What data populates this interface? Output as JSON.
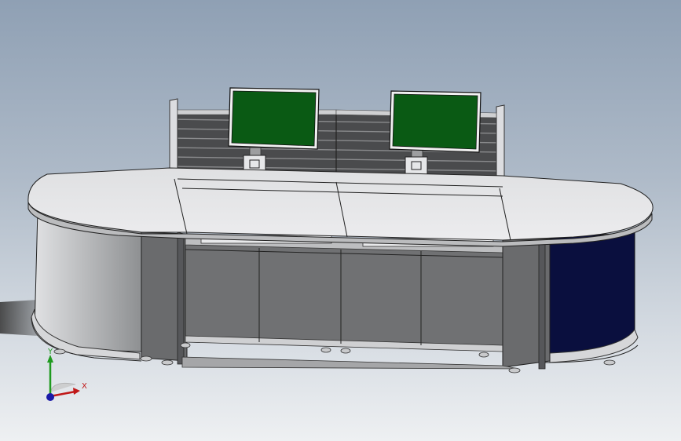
{
  "viewport": {
    "background_top": "#8fa0b4",
    "background_bottom": "#eef0f2"
  },
  "triad": {
    "y_label": "Y",
    "x_label": "X",
    "y_color": "#1f9a1f",
    "x_color": "#c01818",
    "z_color": "#1a1aa8"
  },
  "colors": {
    "desk_top": "#e3e4e6",
    "cabinet": "#6a6b6d",
    "end_panel_left": "#bfc1c3",
    "end_panel_right": "#0a0f3e",
    "screen": "#0a5a14",
    "slat_panel": "#4a4b4d"
  }
}
